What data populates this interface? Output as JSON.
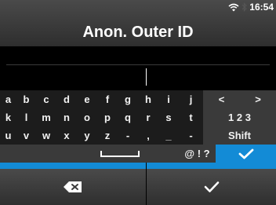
{
  "header": {
    "title": "Anon. Outer ID",
    "time": "16:54"
  },
  "keyboard": {
    "row1": [
      "a",
      "b",
      "c",
      "d",
      "e",
      "f",
      "g",
      "h",
      "i",
      "j",
      "<",
      ">"
    ],
    "row2": [
      "k",
      "l",
      "m",
      "n",
      "o",
      "p",
      "q",
      "r",
      "s",
      "t",
      "1 2 3"
    ],
    "row3": [
      "u",
      "v",
      "w",
      "x",
      "y",
      "z",
      "-",
      ",",
      "_",
      "-",
      "Shift"
    ],
    "row4": {
      "symbols": "@ ! ?"
    }
  },
  "icons": {
    "wifi": "wifi-icon",
    "bluetooth": "bluetooth-icon",
    "backspace": "backspace-icon",
    "enter": "checkmark-icon",
    "confirm": "checkmark-icon",
    "space": "space-icon"
  },
  "colors": {
    "accent": "#138bd6",
    "key_dark": "#3a3a3a",
    "background": "#1c1c1c"
  }
}
